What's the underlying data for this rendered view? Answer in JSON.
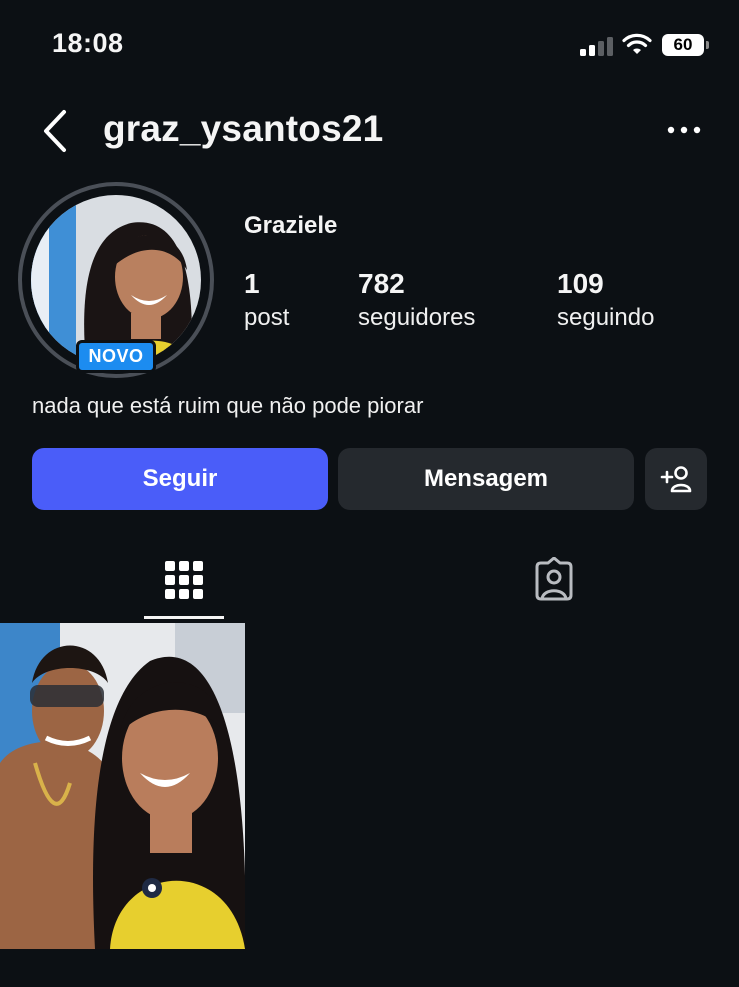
{
  "status_bar": {
    "time": "18:08",
    "battery": "60",
    "icons": [
      "signal-icon",
      "wifi-icon",
      "battery-icon"
    ]
  },
  "header": {
    "username": "graz_ysantos21",
    "back_icon": "chevron-left-icon",
    "more_icon": "more-horizontal-icon"
  },
  "profile": {
    "display_name": "Graziele",
    "badge": "NOVO",
    "stats": [
      {
        "value": "1",
        "label": "post"
      },
      {
        "value": "782",
        "label": "seguidores"
      },
      {
        "value": "109",
        "label": "seguindo"
      }
    ],
    "bio": "nada que está ruim que não pode piorar"
  },
  "actions": {
    "follow_label": "Seguir",
    "message_label": "Mensagem",
    "suggest_icon": "add-person-icon"
  },
  "tabs": [
    {
      "icon": "grid-icon",
      "active": true
    },
    {
      "icon": "tagged-person-icon",
      "active": false
    }
  ],
  "colors": {
    "background": "#0c1014",
    "follow_button": "#4a5df9",
    "secondary_button": "#25292e",
    "badge": "#1c8cf0"
  }
}
